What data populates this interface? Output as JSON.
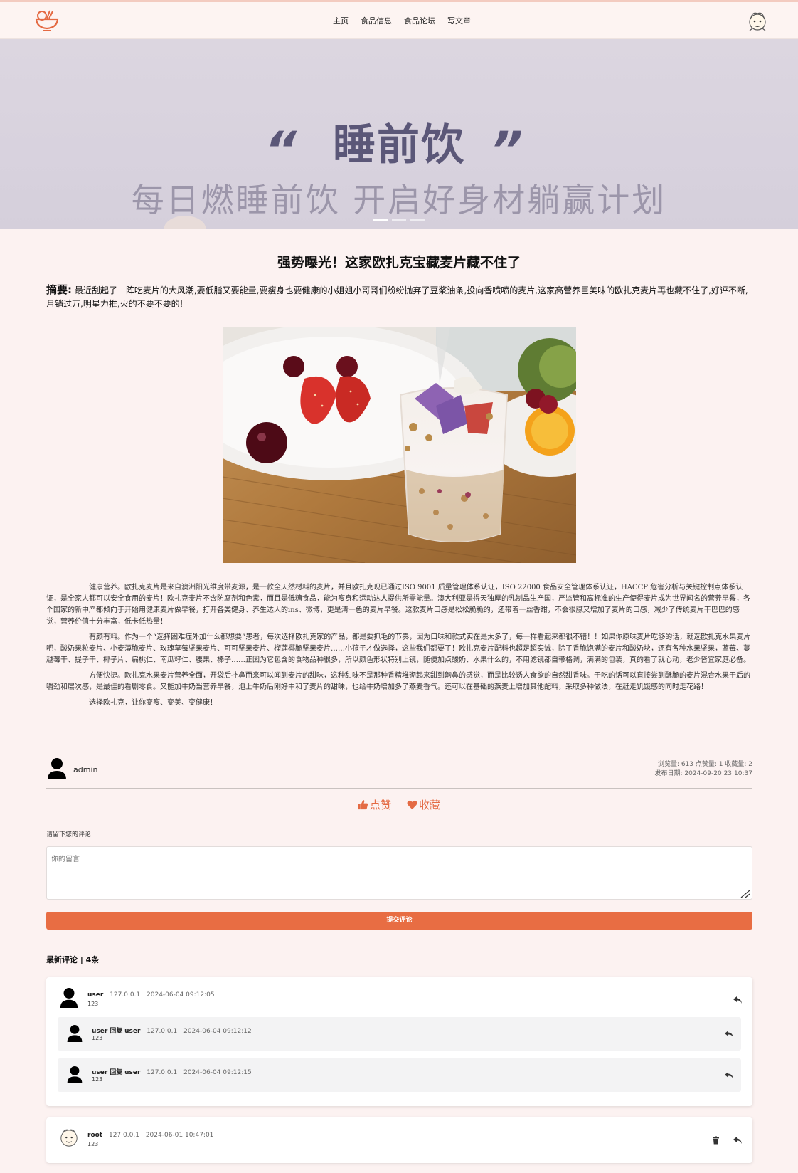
{
  "nav": {
    "links": [
      "主页",
      "食品信息",
      "食品论坛",
      "写文章"
    ]
  },
  "banner": {
    "title": "睡前饮",
    "quote_left": "“",
    "quote_right": "”",
    "subtitle": "每日燃睡前饮 开启好身材躺赢计划",
    "active_slide": 1,
    "slides": 3
  },
  "article": {
    "title": "强势曝光！这家欧扎克宝藏麦片藏不住了",
    "summary_label": "摘要:",
    "summary_text": "最近刮起了一阵吃麦片的大风潮,要低脂又要能量,要瘦身也要健康的小姐姐小哥哥们纷纷抛弃了豆浆油条,投向香喷喷的麦片,这家高营养巨美味的欧扎克麦片再也藏不住了,好评不断,月销过万,明星力推,火的不要不要的!",
    "paragraphs": [
      "健康营养。欧扎克麦片是来自澳洲阳光维度带麦源，是一款全天然材料的麦片，并且欧扎克现已通过ISO 9001 质量管理体系认证，ISO 22000 食品安全管理体系认证，HACCP 危害分析与关键控制点体系认证，是全家人都可以安全食用的麦片！欧扎克麦片不含防腐剂和色素，而且是低糖食品，能为瘦身和运动达人提供所需能量。澳大利亚是得天独厚的乳制品生产国，严监管和高标准的生产使得麦片成为世界闻名的营养早餐，各个国家的新中产都倾向于开始用健康麦片做早餐，打开各类健身、养生达人的ins、微博，更是清一色的麦片早餐。这款麦片口感是松松脆脆的，还带着一丝香甜，不会很腻又增加了麦片的口感，减少了传统麦片干巴巴的感觉，营养价值十分丰富，低卡低热量！",
      "有颜有料。作为一个“选择困难症外加什么都想要”患者，每次选择欧扎克家的产品，都是要抓毛的节奏，因为口味和款式实在是太多了，每一样看起来都很不错！！如果你原味麦片吃够的话，就选欧扎克水果麦片吧，酸奶果粒麦片、小麦薄脆麦片、玫瑰草莓坚果麦片、可可坚果麦片、榴莲椰脆坚果麦片……小孩子才做选择，这些我们都要了！欧扎克麦片配料也超足超实诚，除了香脆饱满的麦片和酸奶块，还有各种水果坚果，蓝莓、蔓越莓干、提子干、椰子片、扁桃仁、南瓜籽仁、腰果、榛子……正因为它包含的食物品种很多，所以颜色形状特别上镜，随便加点酸奶、水果什么的，不用滤镜都自带格调，满满的包装，真的看了就心动，老少皆宜家庭必备。",
      "方便快捷。欧扎克水果麦片营养全面，开袋后扑鼻而来可以闻到麦片的甜味，这种甜味不是那种香精堆砌起来甜到齁鼻的感觉，而是比较诱人食欲的自然甜香味。干吃的话可以直接尝到酥脆的麦片混合水果干后的嚼劲和层次感，是最佳的看剧零食。又能加牛奶当营养早餐，泡上牛奶后刚好中和了麦片的甜味，也给牛奶增加多了燕麦香气。还可以在基础的燕麦上增加其他配料，采取多种做法，在赶走饥饿感的同时走花路！",
      "选择欧扎克，让你变瘦、变美、变健康！"
    ],
    "author": "admin",
    "stats_line": "浏览量: 613  点赞量: 1  收藏量: 2",
    "date_line": "发布日期: 2024-09-20 23:10:37"
  },
  "actions": {
    "like_label": "点赞",
    "fav_label": "收藏"
  },
  "comment_form": {
    "label": "请留下您的评论",
    "placeholder": "你的留言",
    "submit_label": "提交评论"
  },
  "comments": {
    "heading": "最新评论 | 4条",
    "items": [
      {
        "user": "user",
        "ip": "127.0.0.1",
        "time": "2024-06-04 09:12:05",
        "text": "123",
        "replies": [
          {
            "user": "user",
            "reply_word": "回复",
            "target": "user",
            "ip": "127.0.0.1",
            "time": "2024-06-04 09:12:12",
            "text": "123"
          },
          {
            "user": "user",
            "reply_word": "回复",
            "target": "user",
            "ip": "127.0.0.1",
            "time": "2024-06-04 09:12:15",
            "text": "123"
          }
        ]
      },
      {
        "user": "root",
        "ip": "127.0.0.1",
        "time": "2024-06-01 10:47:01",
        "text": "123",
        "replies": []
      }
    ]
  },
  "colors": {
    "accent": "#e86d43",
    "background": "#fcf2f1",
    "banner_text": "#5b5778"
  },
  "icons": {
    "logo": "noodle-bowl-icon",
    "like": "thumbs-up-icon",
    "fav": "heart-icon",
    "reply": "reply-arrow-icon",
    "delete": "trash-icon"
  }
}
